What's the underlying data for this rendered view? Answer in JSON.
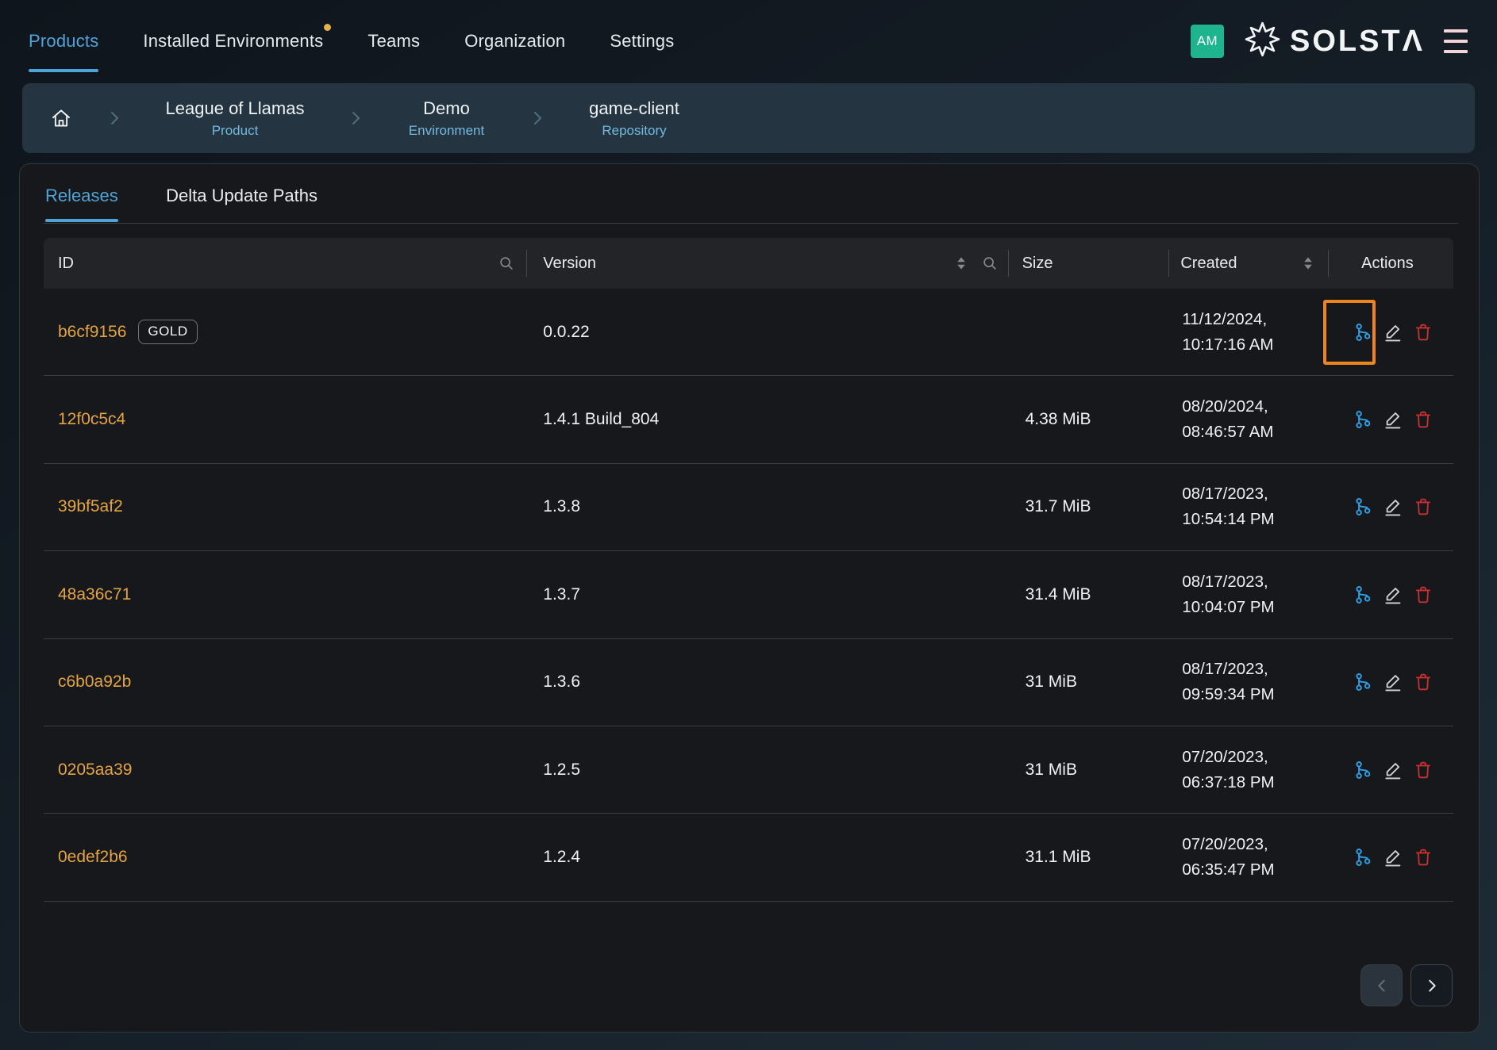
{
  "nav": {
    "items": [
      {
        "label": "Products",
        "active": true
      },
      {
        "label": "Installed Environments",
        "notification": true
      },
      {
        "label": "Teams"
      },
      {
        "label": "Organization"
      },
      {
        "label": "Settings"
      }
    ],
    "avatar_initials": "AM",
    "logo_text": "SOLSTΛ"
  },
  "breadcrumb": {
    "crumbs": [
      {
        "title": "League of Llamas",
        "subtitle": "Product"
      },
      {
        "title": "Demo",
        "subtitle": "Environment"
      },
      {
        "title": "game-client",
        "subtitle": "Repository"
      }
    ]
  },
  "tabs": [
    {
      "label": "Releases",
      "active": true
    },
    {
      "label": "Delta Update Paths",
      "active": false
    }
  ],
  "table": {
    "columns": {
      "id": "ID",
      "version": "Version",
      "size": "Size",
      "created": "Created",
      "actions": "Actions"
    },
    "rows": [
      {
        "id": "b6cf9156",
        "badge": "GOLD",
        "version": "0.0.22",
        "size": "",
        "created_date": "11/12/2024,",
        "created_time": "10:17:16 AM",
        "highlighted": true
      },
      {
        "id": "12f0c5c4",
        "badge": "",
        "version": "1.4.1 Build_804",
        "size": "4.38 MiB",
        "created_date": "08/20/2024,",
        "created_time": "08:46:57 AM",
        "highlighted": false
      },
      {
        "id": "39bf5af2",
        "badge": "",
        "version": "1.3.8",
        "size": "31.7 MiB",
        "created_date": "08/17/2023,",
        "created_time": "10:54:14 PM",
        "highlighted": false
      },
      {
        "id": "48a36c71",
        "badge": "",
        "version": "1.3.7",
        "size": "31.4 MiB",
        "created_date": "08/17/2023,",
        "created_time": "10:04:07 PM",
        "highlighted": false
      },
      {
        "id": "c6b0a92b",
        "badge": "",
        "version": "1.3.6",
        "size": "31 MiB",
        "created_date": "08/17/2023,",
        "created_time": "09:59:34 PM",
        "highlighted": false
      },
      {
        "id": "0205aa39",
        "badge": "",
        "version": "1.2.5",
        "size": "31 MiB",
        "created_date": "07/20/2023,",
        "created_time": "06:37:18 PM",
        "highlighted": false
      },
      {
        "id": "0edef2b6",
        "badge": "",
        "version": "1.2.4",
        "size": "31.1 MiB",
        "created_date": "07/20/2023,",
        "created_time": "06:35:47 PM",
        "highlighted": false
      }
    ]
  },
  "icons": {
    "home": "home-icon",
    "breadcrumb_chevron": "chevron-right-icon",
    "search": "search-icon",
    "sort": "sort-arrows-icon",
    "branch": "git-branch-icon",
    "edit": "edit-pencil-icon",
    "delete": "trash-icon",
    "menu": "hamburger-menu-icon",
    "logo": "solsta-starburst-icon",
    "prev": "chevron-left-icon",
    "next": "chevron-right-icon"
  },
  "colors": {
    "accent_blue": "#4da4d9",
    "id_orange": "#e5a43e",
    "highlight_orange": "#ee861d",
    "branch_blue": "#2d9fe6",
    "delete_red": "#c93030",
    "avatar_teal": "#1db48e",
    "notification_dot": "#e9b04c",
    "panel_bg": "#17181b",
    "header_bg": "#222428",
    "breadcrumb_bg": "#243440"
  }
}
